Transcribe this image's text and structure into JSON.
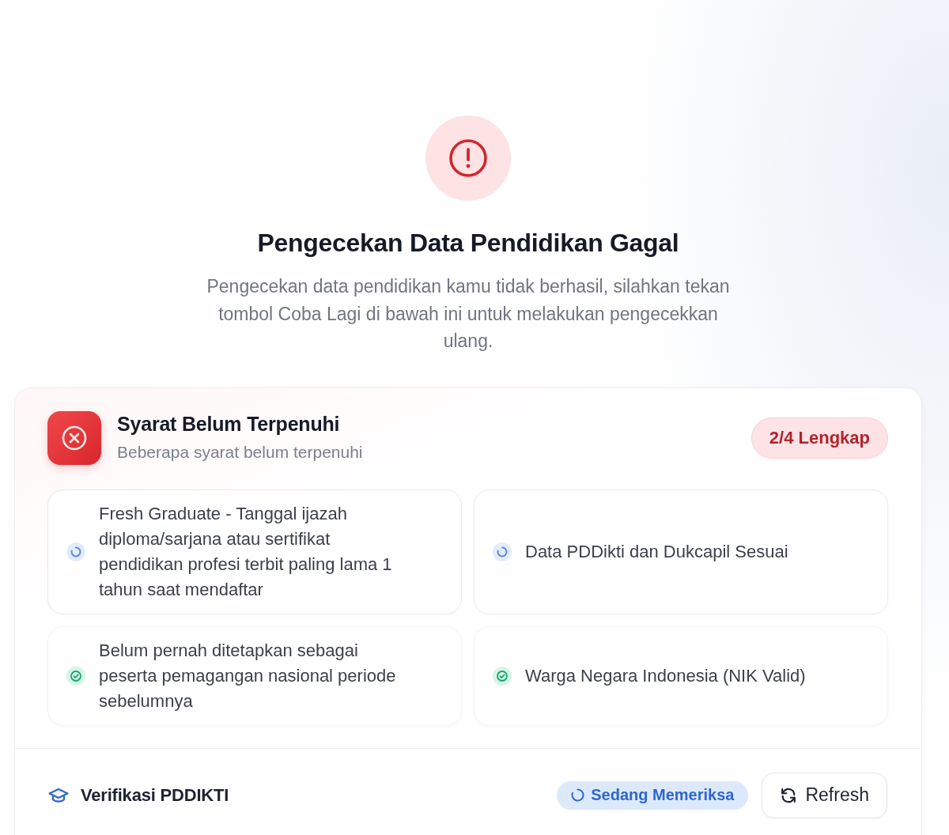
{
  "alert": {
    "title": "Pengecekan Data Pendidikan Gagal",
    "message": "Pengecekan data pendidikan kamu tidak berhasil, silahkan tekan tombol Coba Lagi di bawah ini untuk melakukan pengecekkan ulang."
  },
  "requirements": {
    "title": "Syarat Belum Terpenuhi",
    "subtitle": "Beberapa syarat belum terpenuhi",
    "badge": "2/4 Lengkap",
    "items": [
      {
        "kind": "checking",
        "text": "Fresh Graduate - Tanggal ijazah diploma/sarjana atau sertifikat pendidikan profesi terbit paling lama 1 tahun saat mendaftar"
      },
      {
        "kind": "checking",
        "text": "Data PDDikti dan Dukcapil Sesuai"
      },
      {
        "kind": "passed",
        "text": "Belum pernah ditetapkan sebagai peserta pemagangan nasional periode sebelumnya"
      },
      {
        "kind": "passed",
        "text": "Warga Negara Indonesia (NIK Valid)"
      }
    ]
  },
  "verification": {
    "label": "Verifikasi PDDIKTI",
    "status": "Sedang Memeriksa",
    "button": "Refresh"
  }
}
